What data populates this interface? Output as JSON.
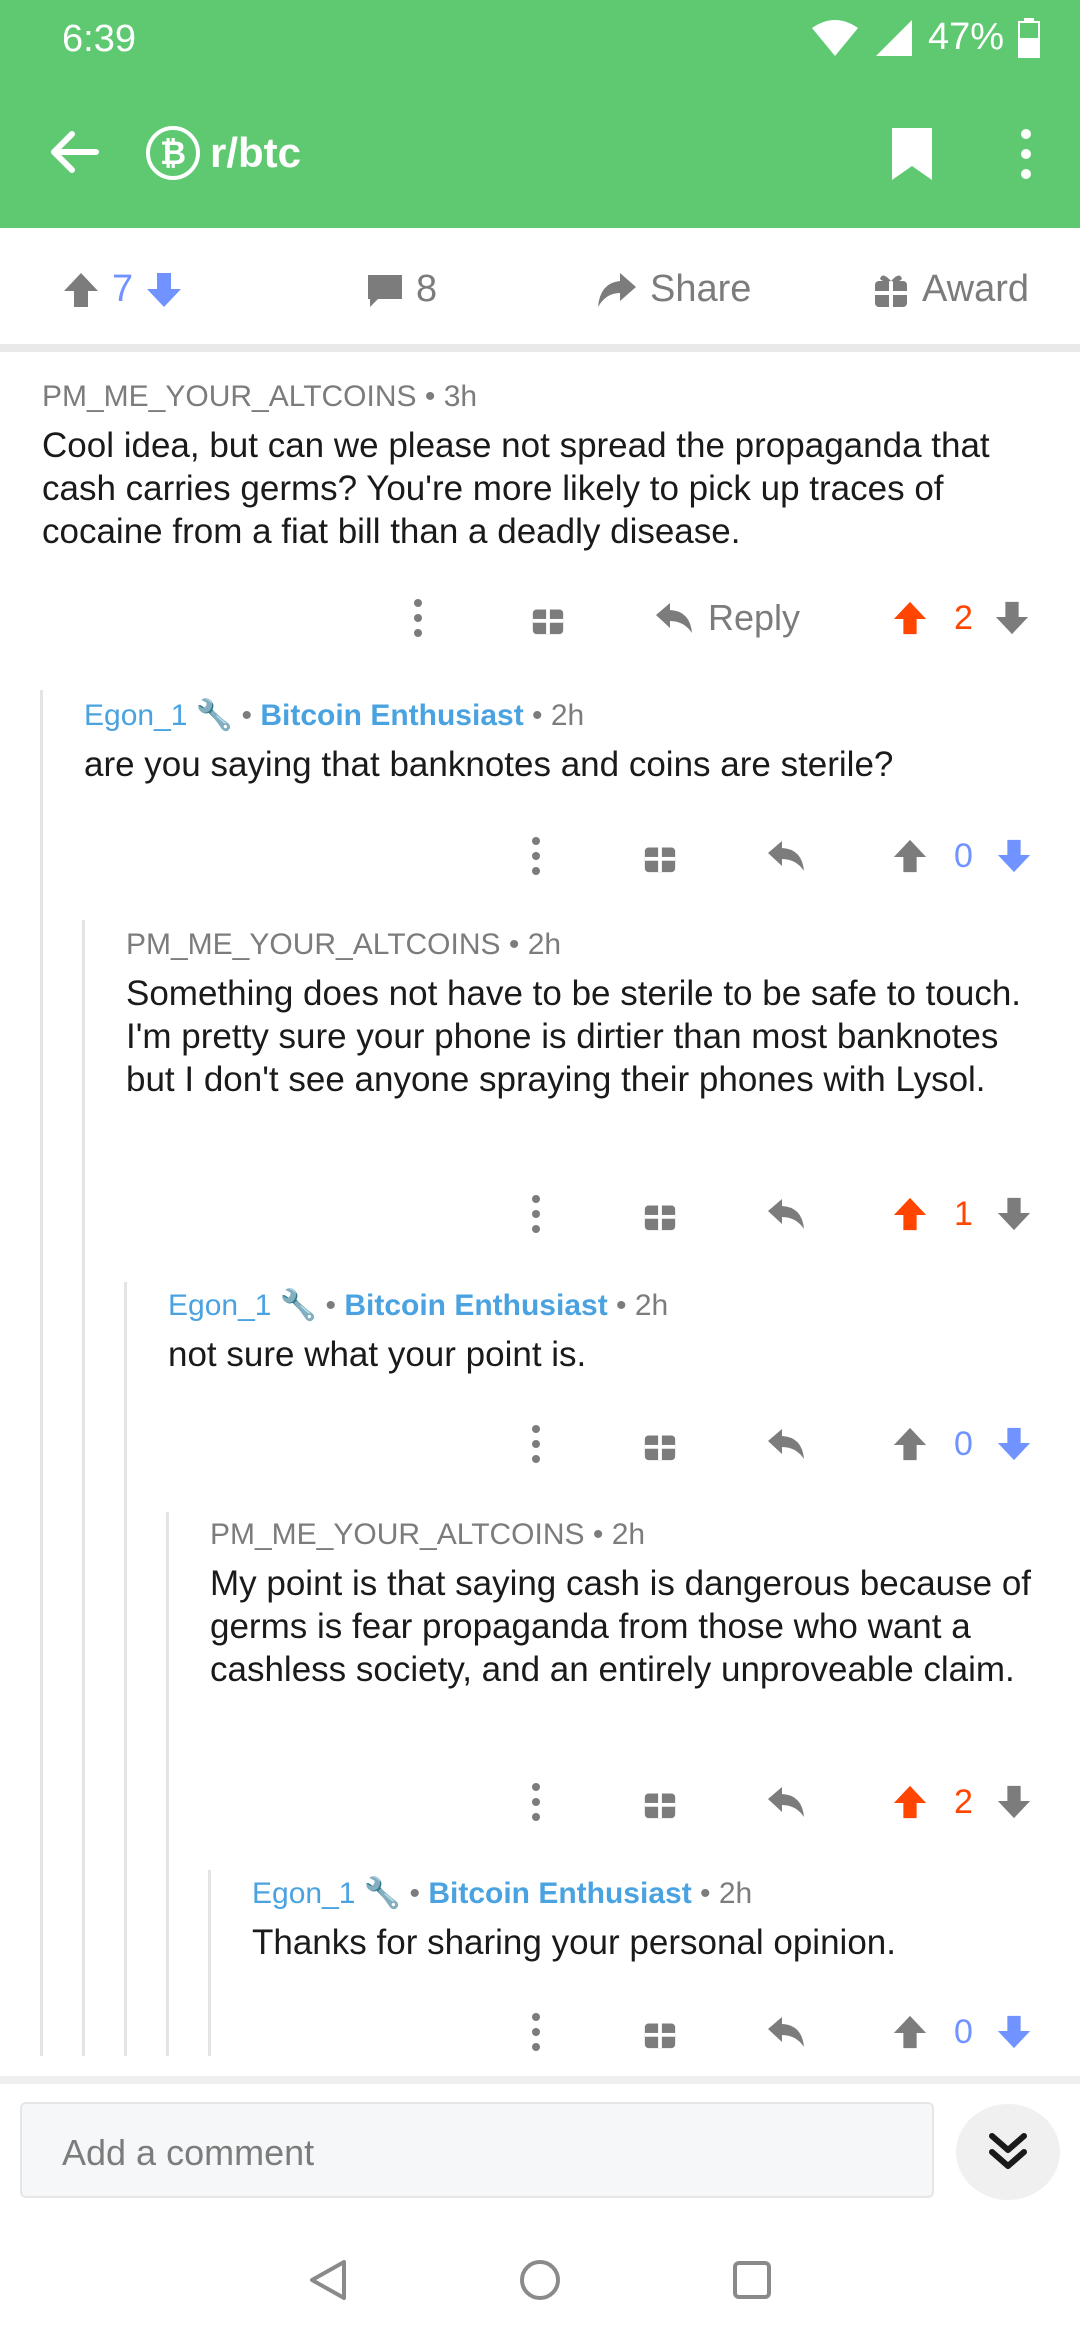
{
  "status": {
    "time": "6:39",
    "battery": "47%"
  },
  "header": {
    "subreddit": "r/btc"
  },
  "post_actions": {
    "votes": "7",
    "comments": "8",
    "share": "Share",
    "award": "Award"
  },
  "comments": [
    {
      "user": "PM_ME_YOUR_ALTCOINS",
      "time": "• 3h",
      "flair": "",
      "body": "Cool idea, but can we please not spread the propaganda that cash carries germs? You're more likely to pick up traces of cocaine from a fiat bill than a deadly disease.",
      "reply_label": "Reply",
      "score": "2"
    },
    {
      "user": "Egon_1",
      "time": "• 2h",
      "flair": "Bitcoin Enthusiast",
      "body": "are you saying that banknotes and coins are sterile?",
      "score": "0"
    },
    {
      "user": "PM_ME_YOUR_ALTCOINS",
      "time": "• 2h",
      "flair": "",
      "body": "Something does not have to be sterile to be safe to touch. I'm pretty sure your phone is dirtier than most banknotes but I don't see anyone spraying their phones with Lysol.",
      "score": "1"
    },
    {
      "user": "Egon_1",
      "time": "• 2h",
      "flair": "Bitcoin Enthusiast",
      "body": "not sure what your point is.",
      "score": "0"
    },
    {
      "user": "PM_ME_YOUR_ALTCOINS",
      "time": "• 2h",
      "flair": "",
      "body": "My point is that saying cash is dangerous because of germs is fear propaganda from those who want a cashless society, and an entirely unproveable claim.",
      "score": "2"
    },
    {
      "user": "Egon_1",
      "time": "• 2h",
      "flair": "Bitcoin Enthusiast",
      "body": "Thanks for sharing your personal opinion.",
      "score": "0"
    }
  ],
  "composer": {
    "placeholder": "Add a comment"
  },
  "colors": {
    "header": "#5ec971",
    "upvote_active": "#ff4500",
    "downvote": "#7193ff",
    "flair": "#4aa3e0"
  }
}
